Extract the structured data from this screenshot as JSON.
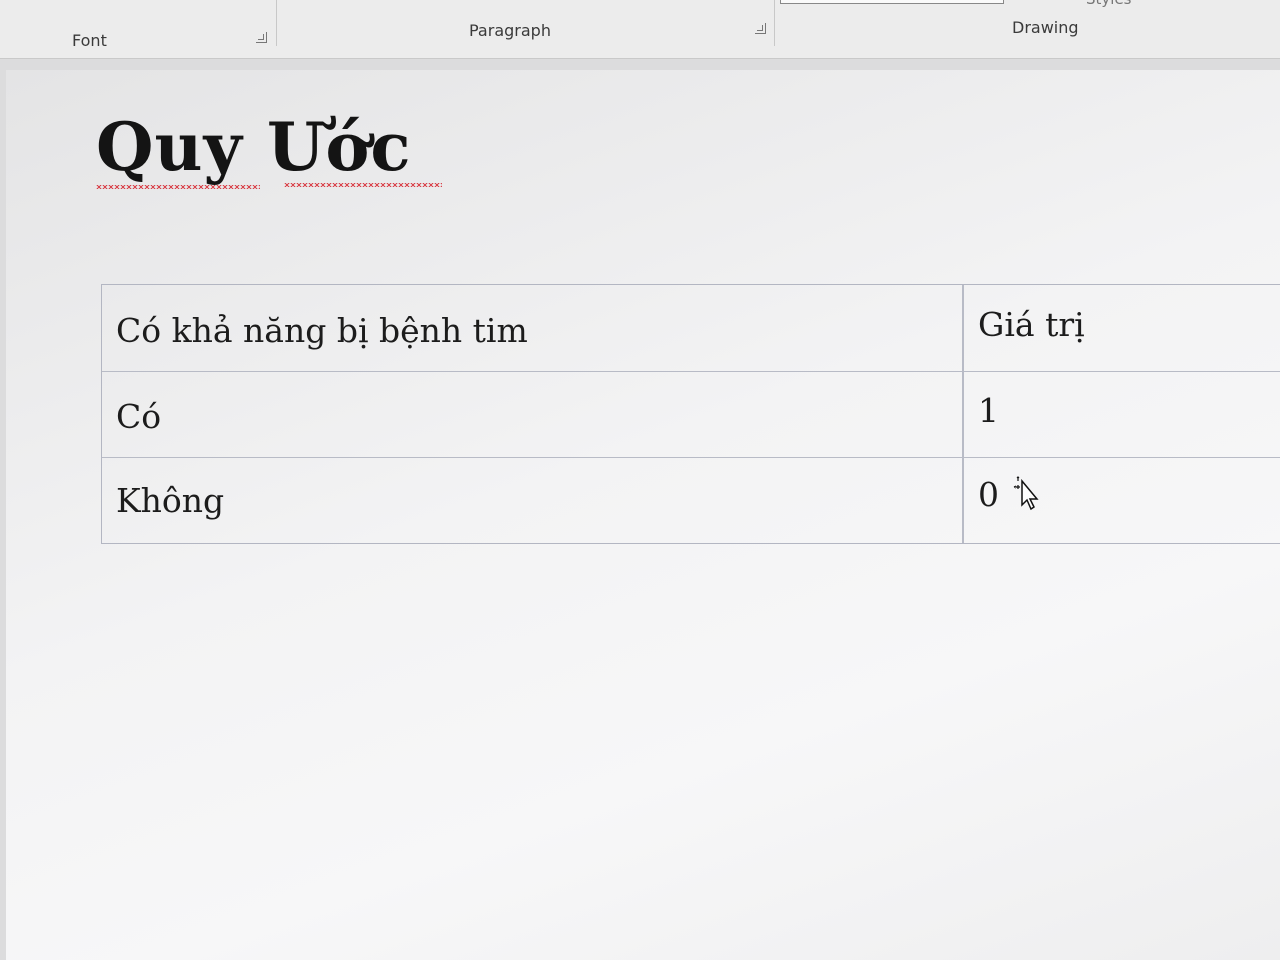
{
  "ribbon": {
    "groups": [
      {
        "label": "Font"
      },
      {
        "label": "Paragraph"
      },
      {
        "label": "Drawing"
      }
    ],
    "styles_label": "Styles"
  },
  "document": {
    "title": "Quy Ước",
    "table": {
      "headers": [
        "Có khả năng bị bệnh tim",
        "Giá trị"
      ],
      "rows": [
        [
          "Có",
          "1"
        ],
        [
          "Không",
          "0"
        ]
      ]
    }
  },
  "colors": {
    "spellcheck_underline": "#d9434b",
    "table_border": "#b8bbc6",
    "text": "#1c1c1c"
  },
  "icons": [
    "dialog-launcher-icon",
    "move-cursor-icon"
  ]
}
